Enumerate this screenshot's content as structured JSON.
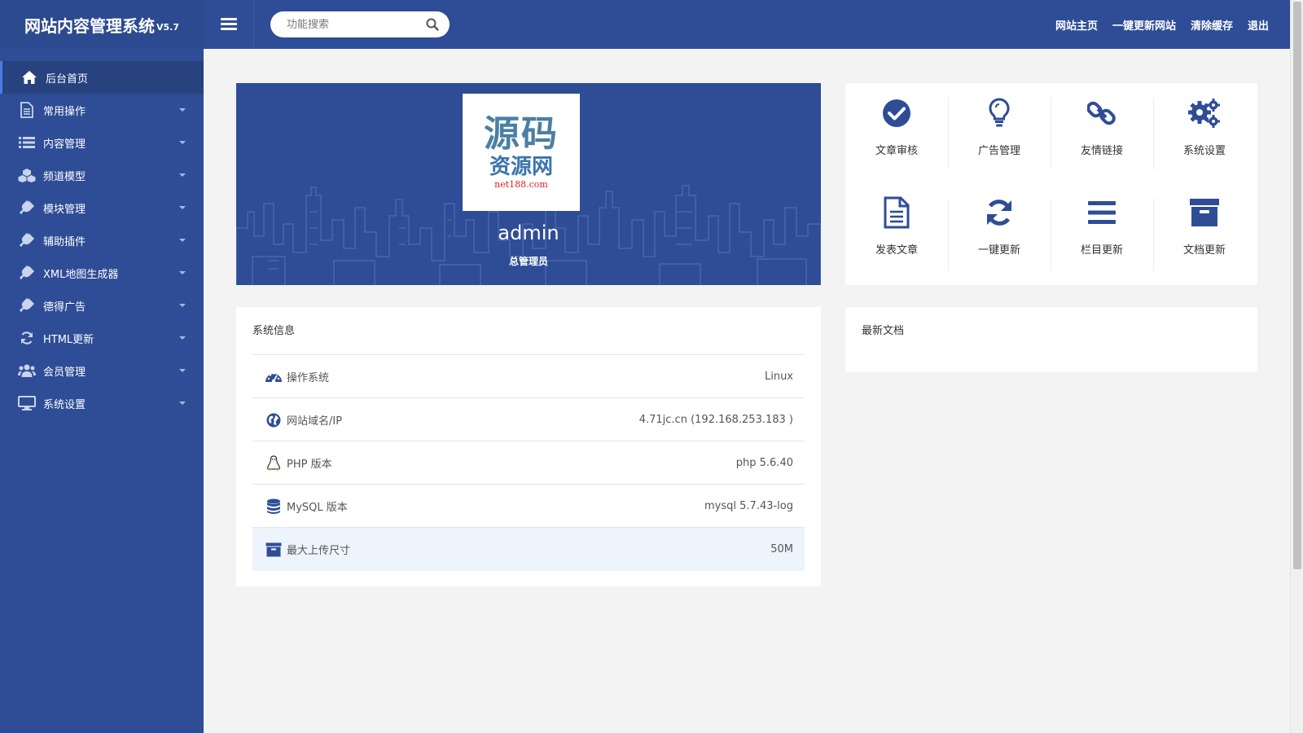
{
  "brand": {
    "name": "网站内容管理系统",
    "version": "V5.7"
  },
  "search": {
    "placeholder": "功能搜索"
  },
  "top_links": [
    "网站主页",
    "一键更新网站",
    "清除缓存",
    "退出"
  ],
  "sidebar": {
    "items": [
      {
        "label": "后台首页",
        "icon": "home-icon",
        "active": true
      },
      {
        "label": "常用操作",
        "icon": "file-icon"
      },
      {
        "label": "内容管理",
        "icon": "list-icon"
      },
      {
        "label": "频道模型",
        "icon": "cubes-icon"
      },
      {
        "label": "模块管理",
        "icon": "plug-icon"
      },
      {
        "label": "辅助插件",
        "icon": "plug-icon"
      },
      {
        "label": "XML地图生成器",
        "icon": "plug-icon"
      },
      {
        "label": "德得广告",
        "icon": "plug-icon"
      },
      {
        "label": "HTML更新",
        "icon": "refresh-icon"
      },
      {
        "label": "会员管理",
        "icon": "users-icon"
      },
      {
        "label": "系统设置",
        "icon": "monitor-icon"
      }
    ]
  },
  "profile": {
    "logo_line1": "源码",
    "logo_line2": "资源网",
    "logo_line3": "net188.com",
    "username": "admin",
    "role": "总管理员"
  },
  "shortcuts": [
    {
      "label": "文章审核",
      "icon": "check-circle-icon"
    },
    {
      "label": "广告管理",
      "icon": "lightbulb-icon"
    },
    {
      "label": "友情链接",
      "icon": "link-icon"
    },
    {
      "label": "系统设置",
      "icon": "gears-icon"
    },
    {
      "label": "发表文章",
      "icon": "document-icon"
    },
    {
      "label": "一键更新",
      "icon": "refresh-icon"
    },
    {
      "label": "栏目更新",
      "icon": "bars-icon"
    },
    {
      "label": "文档更新",
      "icon": "archive-icon"
    }
  ],
  "sysinfo": {
    "title": "系统信息",
    "rows": [
      {
        "label": "操作系统",
        "value": "Linux",
        "icon": "dashboard-icon"
      },
      {
        "label": "网站域名/IP",
        "value": "4.71jc.cn (192.168.253.183 )",
        "icon": "globe-icon"
      },
      {
        "label": "PHP 版本",
        "value": "php 5.6.40",
        "icon": "linux-icon"
      },
      {
        "label": "MySQL 版本",
        "value": "mysql 5.7.43-log",
        "icon": "database-icon"
      },
      {
        "label": "最大上传尺寸",
        "value": "50M",
        "icon": "archive-icon"
      }
    ]
  },
  "latest": {
    "title": "最新文档"
  },
  "colors": {
    "primary": "#2e4d96",
    "sidebar_active": "#27427f",
    "icon": "#2e4d96",
    "highlight_row": "#edf4fb"
  }
}
